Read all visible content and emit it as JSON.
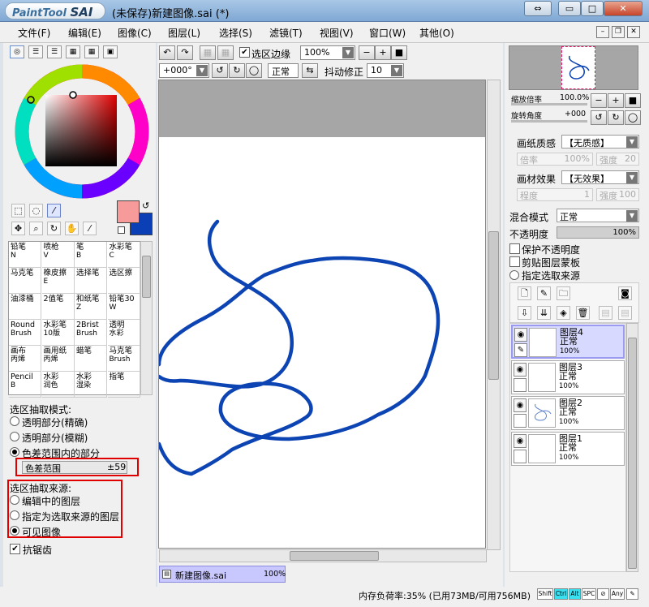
{
  "window": {
    "logo_brand": "PaintTool",
    "logo_name": "SAI",
    "title": "(未保存)新建图像.sai (*)",
    "btn_swap": "⇔",
    "btn_min": "▭",
    "btn_max": "□",
    "btn_close": "✕"
  },
  "menu": [
    {
      "label": "文件(F)"
    },
    {
      "label": "编辑(E)"
    },
    {
      "label": "图像(C)"
    },
    {
      "label": "图层(L)"
    },
    {
      "label": "选择(S)"
    },
    {
      "label": "滤镜(T)"
    },
    {
      "label": "视图(V)"
    },
    {
      "label": "窗口(W)"
    },
    {
      "label": "其他(O)"
    }
  ],
  "colors": {
    "foreground": "#f79a9a",
    "background": "#0b3fb5",
    "accent": "#d7d9ff",
    "stroke": "#0d44b3"
  },
  "brushes": [
    {
      "name": "铅笔",
      "key": "N"
    },
    {
      "name": "喷枪",
      "key": "V"
    },
    {
      "name": "笔",
      "key": "B"
    },
    {
      "name": "水彩笔",
      "key": "C"
    },
    {
      "name": "马克笔",
      "key": ""
    },
    {
      "name": "橡皮擦",
      "key": "E"
    },
    {
      "name": "选择笔",
      "key": ""
    },
    {
      "name": "选区擦",
      "key": ""
    },
    {
      "name": "油漆桶",
      "key": ""
    },
    {
      "name": "2值笔",
      "key": ""
    },
    {
      "name": "和纸笔",
      "key": "Z"
    },
    {
      "name": "铅笔30",
      "key": "W"
    },
    {
      "name": "Round",
      "key": "Brush"
    },
    {
      "name": "水彩笔",
      "key": "10版"
    },
    {
      "name": "2Brist",
      "key": "Brush"
    },
    {
      "name": "透明",
      "key": "水彩"
    },
    {
      "name": "画布",
      "key": "丙烯"
    },
    {
      "name": "画用纸",
      "key": "丙烯"
    },
    {
      "name": "蜡笔",
      "key": ""
    },
    {
      "name": "马克笔",
      "key": "Brush"
    },
    {
      "name": "Pencil",
      "key": "B"
    },
    {
      "name": "水彩",
      "key": "润色"
    },
    {
      "name": "水彩",
      "key": "湿染"
    },
    {
      "name": "指笔",
      "key": ""
    }
  ],
  "selection_mode": {
    "title": "选区抽取模式:",
    "options": [
      {
        "label": "透明部分(精确)"
      },
      {
        "label": "透明部分(模糊)"
      },
      {
        "label": "色差范围内的部分"
      }
    ],
    "selected": 2,
    "range_label": "色差范围",
    "range_value": "±59"
  },
  "selection_source": {
    "title": "选区抽取来源:",
    "options": [
      {
        "label": "编辑中的图层"
      },
      {
        "label": "指定为选取来源的图层"
      },
      {
        "label": "可见图像"
      }
    ],
    "selected": 2
  },
  "antialias": {
    "label": "抗锯齿",
    "checked": true
  },
  "canvas_toolbar": {
    "show_selection_label": "选区边缘",
    "zoom": "100%",
    "rotation": "+000°",
    "blend": "正常",
    "stabilizer_label": "抖动修正",
    "stabilizer_value": "10"
  },
  "navigator": {
    "zoom_label": "缩放倍率",
    "zoom_value": "100.0%",
    "rotate_label": "旋转角度",
    "rotate_value": "+000"
  },
  "texture": {
    "paper_label": "画纸质感",
    "paper_value": "【无质感】",
    "rate_label": "倍率",
    "rate_value": "100%",
    "strength_label": "强度",
    "strength_value": "20",
    "effect_label": "画材效果",
    "effect_value": "【无效果】",
    "degree_label": "程度",
    "degree_value": "1",
    "strength2_label": "强度",
    "strength2_value": "100"
  },
  "layer_props": {
    "blend_label": "混合模式",
    "blend_value": "正常",
    "opacity_label": "不透明度",
    "opacity_value": "100%",
    "protect_label": "保护不透明度",
    "clip_label": "剪贴图层蒙板",
    "source_label": "指定选取来源"
  },
  "layers": [
    {
      "name": "图层4",
      "mode": "正常",
      "opacity": "100%",
      "selected": true
    },
    {
      "name": "图层3",
      "mode": "正常",
      "opacity": "100%",
      "selected": false
    },
    {
      "name": "图层2",
      "mode": "正常",
      "opacity": "100%",
      "selected": false
    },
    {
      "name": "图层1",
      "mode": "正常",
      "opacity": "100%",
      "selected": false
    }
  ],
  "doc_tab": {
    "name": "新建图像.sai",
    "zoom": "100%"
  },
  "status": {
    "memory": "内存负荷率:35% (已用73MB/可用756MB)",
    "keys": [
      "Shift",
      "Ctrl",
      "Alt",
      "SPC",
      "⊘",
      "Any"
    ]
  }
}
